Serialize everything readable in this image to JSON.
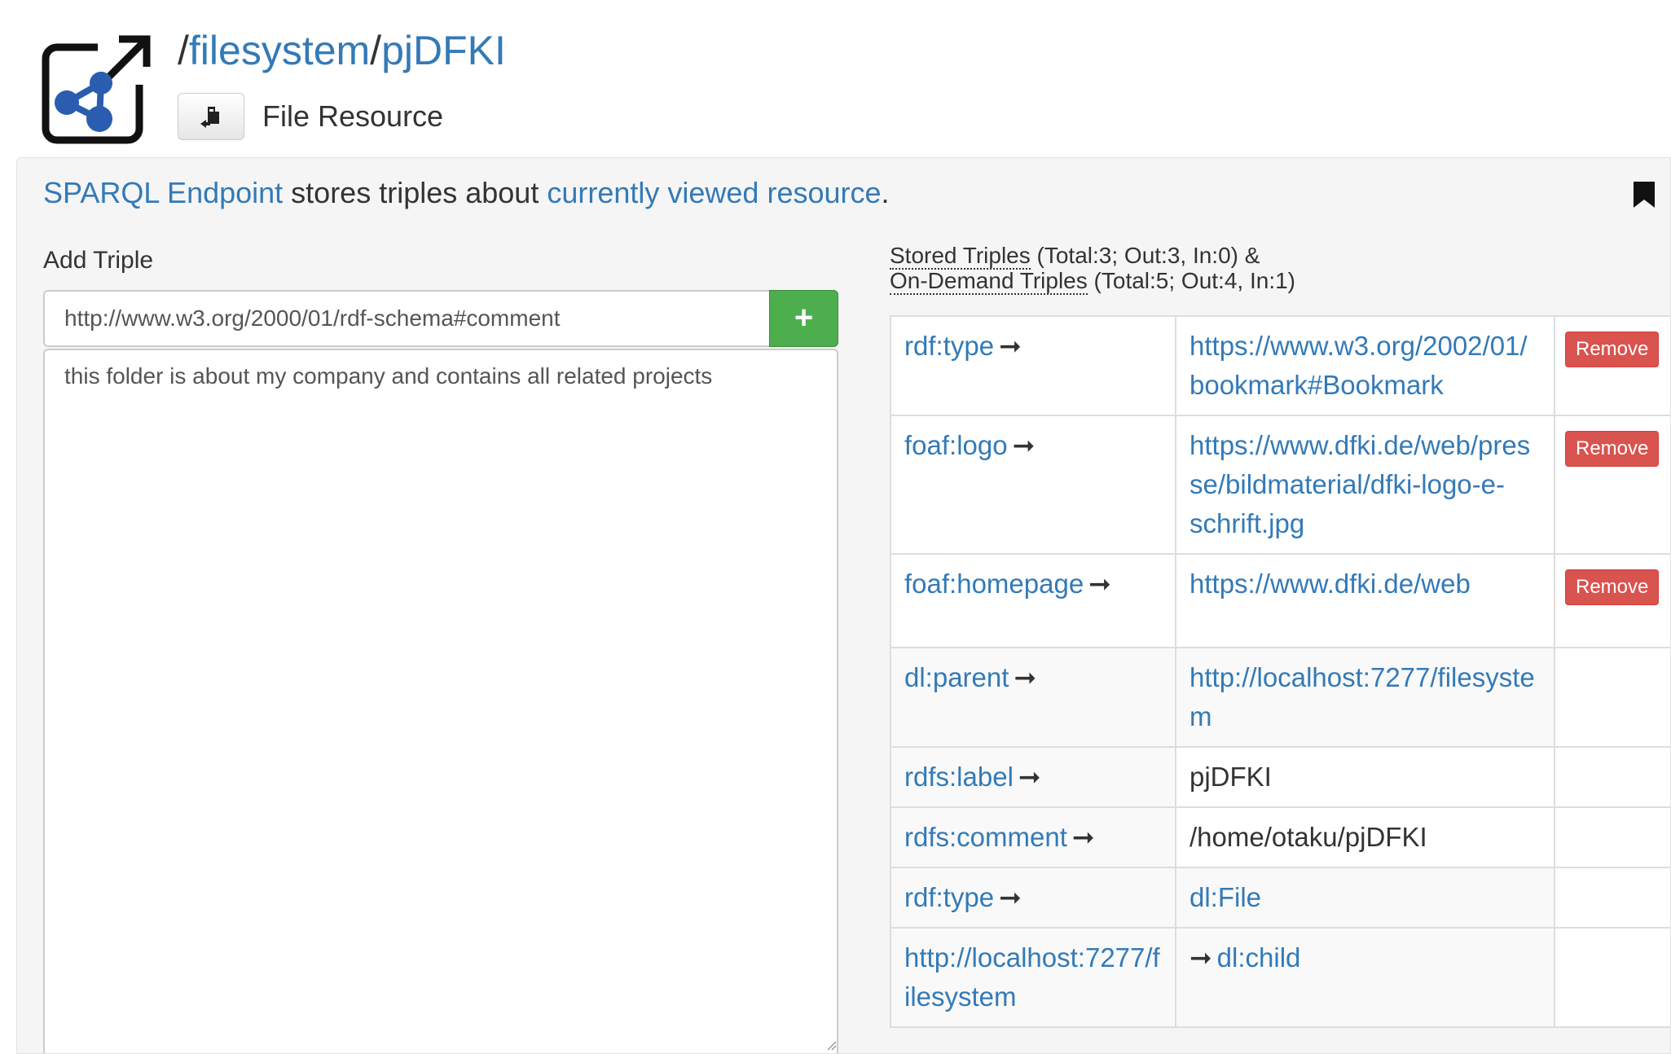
{
  "header": {
    "path_separator": "/",
    "path_segments": [
      "filesystem",
      "pjDFKI"
    ],
    "type_label": "File Resource",
    "type_icon": "file-plugin-icon",
    "logo_icon": "linked-data-app-logo-icon"
  },
  "intro": {
    "link_endpoint": "SPARQL Endpoint",
    "middle_text": " stores triples about ",
    "link_resource": "currently viewed resource",
    "end_text": "."
  },
  "add_triple": {
    "title": "Add Triple",
    "predicate_value": "http://www.w3.org/2000/01/rdf-schema#comment",
    "object_value": "this folder is about my company and contains all related projects",
    "add_label": "+"
  },
  "triples_header": {
    "stored_label": "Stored Triples",
    "stored_counts": " (Total:3; Out:3, In:0) &",
    "ondemand_label": "On-Demand Triples",
    "ondemand_counts": " (Total:5; Out:4, In:1)"
  },
  "arrow": "➞",
  "remove_label": "Remove",
  "stored_triples": [
    {
      "predicate": "rdf:type",
      "object": "https://www.w3.org/2002/01/bookmark#Bookmark"
    },
    {
      "predicate": "foaf:logo",
      "object": "https://www.dfki.de/web/presse/bildmaterial/dfki-logo-e-schrift.jpg"
    },
    {
      "predicate": "foaf:homepage",
      "object": "https://www.dfki.de/web"
    }
  ],
  "ondemand_triples": [
    {
      "predicate": "dl:parent",
      "object": "http://localhost:7277/filesystem"
    },
    {
      "predicate": "rdfs:label",
      "object": "pjDFKI"
    },
    {
      "predicate": "rdfs:comment",
      "object": "/home/otaku/pjDFKI"
    },
    {
      "predicate": "rdf:type",
      "object": "dl:File"
    },
    {
      "subject": "http://localhost:7277/filesystem",
      "predicate": "dl:child"
    }
  ],
  "colors": {
    "link": "#337ab7",
    "add_button": "#4cae4c",
    "remove_button": "#d9534f",
    "panel_background": "#f5f5f5",
    "logo_blue": "#2a5db0"
  }
}
